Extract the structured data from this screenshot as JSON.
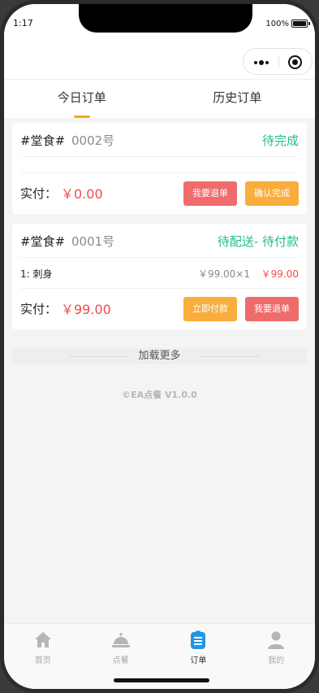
{
  "status_bar": {
    "time": "1:17",
    "battery_percent": "100%"
  },
  "tabs": [
    {
      "label": "今日订单",
      "active": true
    },
    {
      "label": "历史订单",
      "active": false
    }
  ],
  "orders": [
    {
      "type": "#堂食#",
      "number": "0002号",
      "status": "待完成",
      "items": [],
      "paid_label": "实付：",
      "paid_amount": "￥0.00",
      "buttons": [
        "我要退单",
        "确认完成"
      ]
    },
    {
      "type": "#堂食#",
      "number": "0001号",
      "status": "待配送- 待付款",
      "items": [
        {
          "name": "1: 刺身",
          "unit_qty": "￥99.00×1",
          "total": "￥99.00"
        }
      ],
      "paid_label": "实付：",
      "paid_amount": "￥99.00",
      "buttons": [
        "立即付款",
        "我要退单"
      ]
    }
  ],
  "load_more": "加载更多",
  "copyright": "©EA点餐 V1.0.0",
  "tabbar": [
    {
      "label": "首页",
      "icon": "home-icon",
      "active": false
    },
    {
      "label": "点餐",
      "icon": "dish-cover-icon",
      "active": false
    },
    {
      "label": "订单",
      "icon": "order-list-icon",
      "active": true
    },
    {
      "label": "我的",
      "icon": "person-icon",
      "active": false
    }
  ],
  "colors": {
    "accent_orange": "#f9ad3d",
    "status_green": "#1fbf7f",
    "price_red": "#f24b4b",
    "button_red": "#f06b6b",
    "active_blue": "#2196e8"
  }
}
